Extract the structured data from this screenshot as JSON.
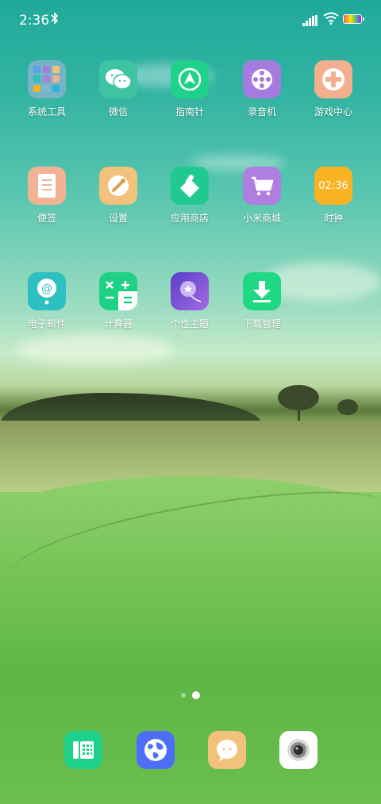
{
  "status_bar": {
    "time": "2:36",
    "bluetooth_icon": "bluetooth-icon",
    "signal_icon": "signal-icon",
    "wifi_icon": "wifi-icon",
    "battery_icon": "battery-icon"
  },
  "apps": [
    {
      "label": "系统工具",
      "icon": "folder-icon",
      "color": "#7fb8d6"
    },
    {
      "label": "微信",
      "icon": "wechat-icon",
      "color": "#3ec4a2"
    },
    {
      "label": "指南针",
      "icon": "compass-icon",
      "color": "#1fd28a"
    },
    {
      "label": "录音机",
      "icon": "recorder-icon",
      "color": "#a57be0"
    },
    {
      "label": "游戏中心",
      "icon": "gamepad-icon",
      "color": "#f2b08e"
    },
    {
      "label": "便签",
      "icon": "notes-icon",
      "color": "#f2b394"
    },
    {
      "label": "设置",
      "icon": "settings-icon",
      "color": "#f2c27c"
    },
    {
      "label": "应用商店",
      "icon": "app-store-icon",
      "color": "#20c98f"
    },
    {
      "label": "小米商城",
      "icon": "cart-icon",
      "color": "#b07ee0"
    },
    {
      "label": "时钟",
      "icon": "clock-icon",
      "color": "#f9b320",
      "clock_text": "02:36"
    },
    {
      "label": "电子邮件",
      "icon": "email-icon",
      "color": "#2cc0c0"
    },
    {
      "label": "计算器",
      "icon": "calculator-icon",
      "color": "#1ed184"
    },
    {
      "label": "个性主题",
      "icon": "theme-icon",
      "color": "#6e4fd6"
    },
    {
      "label": "下载管理",
      "icon": "download-icon",
      "color": "#1fd883"
    }
  ],
  "page_indicator": {
    "pages": 2,
    "current": 2
  },
  "dock": [
    {
      "icon": "phone-icon",
      "color": "#1fd08a"
    },
    {
      "icon": "browser-icon",
      "color": "#4f6ef7"
    },
    {
      "icon": "messages-icon",
      "color": "#f2c27c"
    },
    {
      "icon": "camera-icon",
      "color": "#ffffff"
    }
  ]
}
